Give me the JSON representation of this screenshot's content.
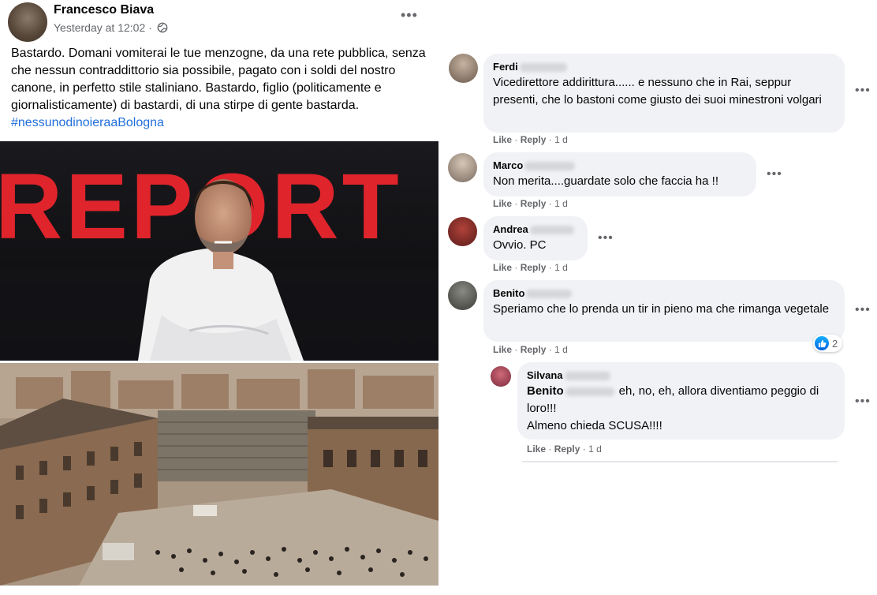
{
  "post": {
    "author": "Francesco Biava",
    "time": "Yesterday at 12:02 ·",
    "text": "Bastardo. Domani vomiterai le tue menzogne, da una rete pubblica, senza che nessun contraddittorio sia possibile, pagato con i soldi del nostro canone, in perfetto stile staliniano. Bastardo, figlio (politicamente e giornalisticamente) di bastardi, di una stirpe di gente bastarda.",
    "hashtag": "#nessunodinoieraaBologna",
    "menu": "•••",
    "report_logo": "REPORT"
  },
  "comments": [
    {
      "name": "Ferdi",
      "text": "Vicedirettore addirittura...... e nessuno che in Rai, seppur presenti, che lo bastoni come giusto dei suoi minestroni volgari",
      "like": "Like",
      "reply": "Reply",
      "age": "1 d"
    },
    {
      "name": "Marco",
      "text": "Non merita....guardate solo che faccia ha !!",
      "like": "Like",
      "reply": "Reply",
      "age": "1 d"
    },
    {
      "name": "Andrea",
      "text": "Ovvio. PC",
      "like": "Like",
      "reply": "Reply",
      "age": "1 d"
    },
    {
      "name": "Benito",
      "text": "Speriamo che lo prenda un tir in pieno ma che rimanga vegetale",
      "like": "Like",
      "reply": "Reply",
      "age": "1 d",
      "reactions": "2"
    }
  ],
  "reply": {
    "name": "Silvana",
    "mention": "Benito",
    "text1": "eh, no, eh, allora diventiamo peggio di loro!!!",
    "text2": "Almeno chieda SCUSA!!!!",
    "like": "Like",
    "reply": "Reply",
    "age": "1 d"
  },
  "sep": "·",
  "dots": "•••",
  "colors": {
    "link": "#216fdb",
    "bubble": "#f0f2f5",
    "meta": "#65676b",
    "report_red": "#e0242c"
  }
}
